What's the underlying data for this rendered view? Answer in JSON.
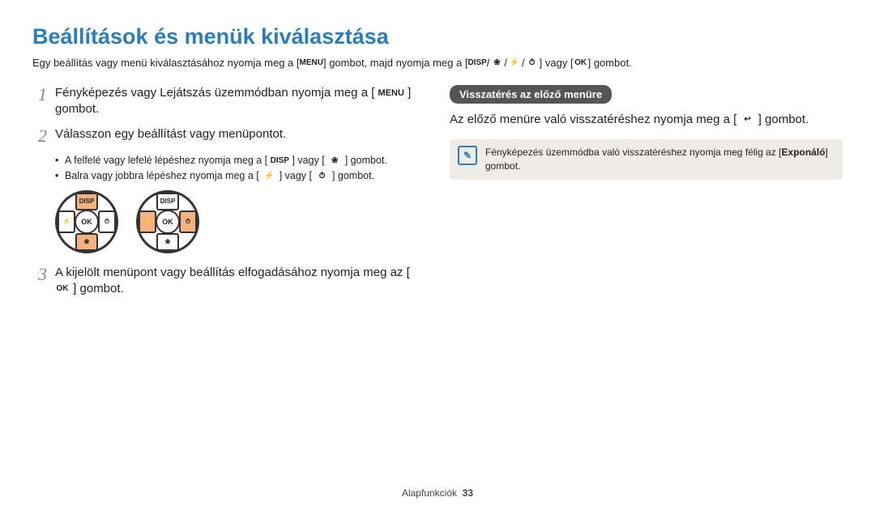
{
  "title": "Beállítások és menük kiválasztása",
  "intro_a": "Egy beállítás vagy menü kiválasztásához nyomja meg a [",
  "intro_b": "] gombot, majd nyomja meg a [",
  "intro_c": "] vagy [",
  "intro_d": "] gombot.",
  "icons": {
    "menu": "MENU",
    "disp": "DISP",
    "flower": "❀",
    "flash": "⚡",
    "timer": "⏱",
    "ok": "OK",
    "back": "↩",
    "note": "✎",
    "slash": " / "
  },
  "left": {
    "step1_num": "1",
    "step1_a": "Fényképezés vagy Lejátszás üzemmódban nyomja meg a [",
    "step1_b": "] gombot.",
    "step2_num": "2",
    "step2": "Válasszon egy beállítást vagy menüpontot.",
    "bullet1_a": "A felfelé vagy lefelé lépéshez nyomja meg a [",
    "bullet1_b": "] vagy [",
    "bullet1_c": "] gombot.",
    "bullet2_a": "Balra vagy jobbra lépéshez nyomja meg a [",
    "bullet2_b": "] vagy [",
    "bullet2_c": "] gombot.",
    "step3_num": "3",
    "step3_a": "A kijelölt menüpont vagy beállítás elfogadásához nyomja meg az [",
    "step3_b": "] gombot."
  },
  "dpad": {
    "top": "DISP",
    "center": "OK",
    "bottom": "❀",
    "left": "⚡",
    "right": "⏱"
  },
  "right": {
    "badge": "Visszatérés az előző menüre",
    "para_a": "Az előző menüre való visszatéréshez nyomja meg a [",
    "para_b": "] gombot.",
    "note_a": "Fényképezés üzemmódba való visszatéréshez nyomja meg félig az [",
    "note_bold": "Exponáló",
    "note_b": "] gombot."
  },
  "footer": {
    "section": "Alapfunkciók",
    "page": "33"
  }
}
